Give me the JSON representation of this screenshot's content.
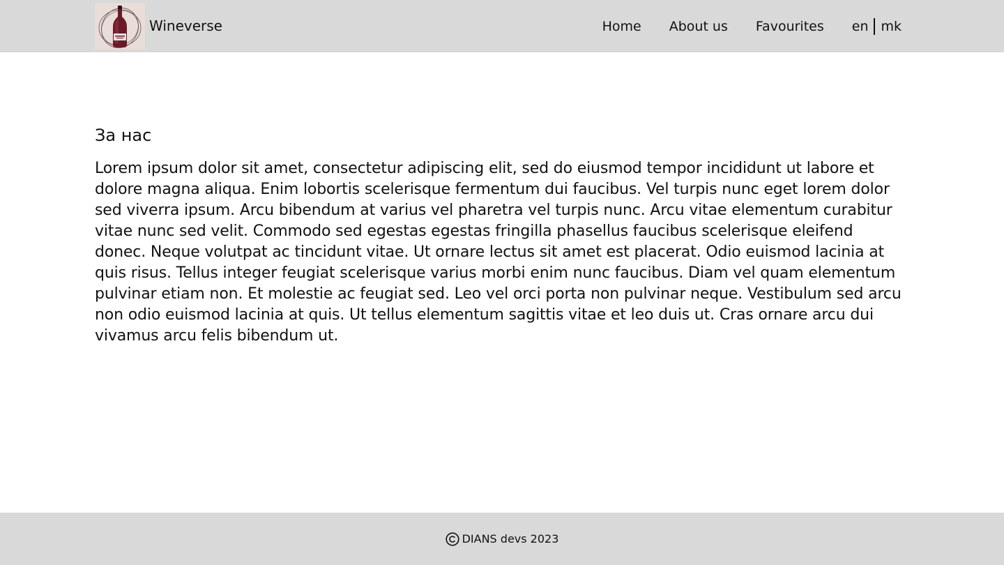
{
  "header": {
    "brand_name": "Wineverse",
    "logo_icon": "wine-bottle-icon",
    "nav": {
      "home": "Home",
      "about": "About us",
      "favourites": "Favourites"
    },
    "languages": {
      "en": "en",
      "mk": "mk"
    }
  },
  "main": {
    "title": "За нас",
    "paragraph": "Lorem ipsum dolor sit amet, consectetur adipiscing elit, sed do eiusmod tempor incididunt ut labore et dolore magna aliqua. Enim lobortis scelerisque fermentum dui faucibus. Vel turpis nunc eget lorem dolor sed viverra ipsum. Arcu bibendum at varius vel pharetra vel turpis nunc. Arcu vitae elementum curabitur vitae nunc sed velit. Commodo sed egestas egestas fringilla phasellus faucibus scelerisque eleifend donec. Neque volutpat ac tincidunt vitae. Ut ornare lectus sit amet est placerat. Odio euismod lacinia at quis risus. Tellus integer feugiat scelerisque varius morbi enim nunc faucibus. Diam vel quam elementum pulvinar etiam non. Et molestie ac feugiat sed. Leo vel orci porta non pulvinar neque. Vestibulum sed arcu non odio euismod lacinia at quis. Ut tellus elementum sagittis vitae et leo duis ut. Cras ornare arcu dui vivamus arcu felis bibendum ut."
  },
  "footer": {
    "copyright_icon": "copyright-icon",
    "copyright_text": "DIANS devs 2023"
  },
  "colors": {
    "header_bg": "#d9d9d9",
    "footer_bg": "#d9d9d9",
    "page_bg": "#ffffff",
    "text": "#111111",
    "wine": "#6b1a2a"
  }
}
